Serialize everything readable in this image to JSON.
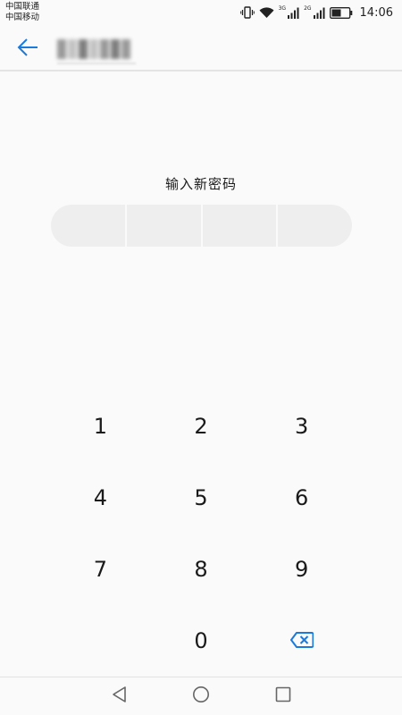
{
  "status_bar": {
    "carrier_1": "中国联通",
    "carrier_2": "中国移动",
    "network_1": "3G",
    "network_2": "2G",
    "time": "14:06",
    "icons": [
      "vibrate-icon",
      "wifi-icon",
      "signal-icon",
      "signal-icon",
      "battery-icon"
    ]
  },
  "title_bar": {
    "back_icon": "arrow-left-icon",
    "accent_color": "#1a7bdc"
  },
  "pin_entry": {
    "prompt": "输入新密码",
    "box_count": 4
  },
  "keypad": {
    "keys": [
      "1",
      "2",
      "3",
      "4",
      "5",
      "6",
      "7",
      "8",
      "9",
      "0"
    ],
    "delete_icon": "backspace-icon"
  },
  "nav_bar": {
    "icons": [
      "back-triangle-icon",
      "home-circle-icon",
      "recents-square-icon"
    ]
  }
}
